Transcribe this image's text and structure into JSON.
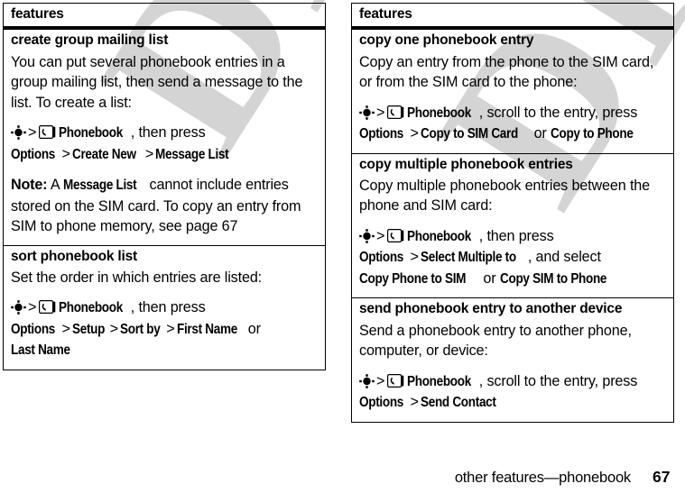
{
  "document": {
    "footer_title": "other features—phonebook",
    "page_number": "67",
    "watermark": "DRAFT"
  },
  "icons": {
    "nav_key": "navigation-key-icon",
    "phonebook": "phonebook-icon"
  },
  "columns": [
    {
      "header": "features",
      "sections": [
        {
          "title": "create group mailing list",
          "paragraphs": [
            "You can put several phonebook entries in a group mailing list, then send a message to the list. To create a list:"
          ],
          "steps": [
            {
              "nav": true,
              "sep1": ">",
              "pbicon": true,
              "app": "Phonebook",
              "after_app": ", then press"
            },
            {
              "tokens": [
                "Options",
                ">",
                "Create New",
                ">",
                "Message List"
              ]
            }
          ],
          "note": {
            "label": "Note:",
            "pre": " A ",
            "token": "Message List",
            "post": " cannot include entries stored on the SIM card. To copy an entry from SIM to phone memory, see page 67"
          }
        },
        {
          "title": "sort phonebook list",
          "paragraphs": [
            "Set the order in which entries are listed:"
          ],
          "steps": [
            {
              "nav": true,
              "sep1": ">",
              "pbicon": true,
              "app": "Phonebook",
              "after_app": ", then press"
            },
            {
              "tokens": [
                "Options",
                ">",
                "Setup",
                ">",
                "Sort by",
                ">",
                "First Name",
                "or",
                "Last Name"
              ]
            }
          ]
        }
      ]
    },
    {
      "header": "features",
      "sections": [
        {
          "title": "copy one phonebook entry",
          "paragraphs": [
            "Copy an entry from the phone to the SIM card, or from the SIM card to the phone:"
          ],
          "steps": [
            {
              "nav": true,
              "sep1": ">",
              "pbicon": true,
              "app": "Phonebook",
              "after_app": ", scroll to the entry, press"
            },
            {
              "tokens": [
                "Options",
                ">",
                "Copy to SIM Card",
                "or",
                "Copy to Phone"
              ]
            }
          ]
        },
        {
          "title": "copy multiple phonebook entries",
          "paragraphs": [
            "Copy multiple phonebook entries between the phone and SIM card:"
          ],
          "steps": [
            {
              "nav": true,
              "sep1": ">",
              "pbicon": true,
              "app": "Phonebook",
              "after_app": ", then press"
            },
            {
              "tokens": [
                "Options",
                ">",
                "Select Multiple to",
                ", and select"
              ]
            },
            {
              "tokens": [
                "Copy Phone to SIM",
                "or",
                "Copy SIM to Phone"
              ]
            }
          ]
        },
        {
          "title": "send phonebook entry to another device",
          "paragraphs": [
            "Send a phonebook entry to another phone, computer, or device:"
          ],
          "steps": [
            {
              "nav": true,
              "sep1": ">",
              "pbicon": true,
              "app": "Phonebook",
              "after_app": ", scroll to the entry, press"
            },
            {
              "tokens": [
                "Options",
                ">",
                "Send Contact"
              ]
            }
          ]
        }
      ]
    }
  ]
}
